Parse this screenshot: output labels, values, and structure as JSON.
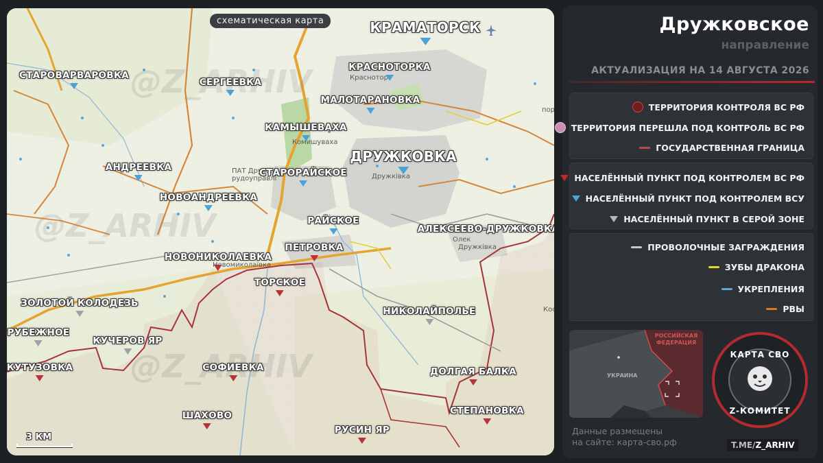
{
  "map": {
    "badge": "схематическая карта",
    "scale": "3 КМ",
    "watermark": "@Z_ARHIV",
    "under_labels": [
      "Краснотор",
      "Комишуваха",
      "ПАТ Дружків",
      "рудоуправлі",
      "Дружківка",
      "Олек",
      "Дружківка",
      "Новомиколаївка",
      "Кост",
      "пор"
    ],
    "towns": [
      {
        "name": "КРАМАТОРСК",
        "control": "ua",
        "size": "big"
      },
      {
        "name": "ДРУЖКОВКА",
        "control": "ua",
        "size": "big"
      },
      {
        "name": "СТАРОВАРВАРОВКА",
        "control": "ua"
      },
      {
        "name": "СЕРГЕЕВКА",
        "control": "ua"
      },
      {
        "name": "КРАСНОТОРКА",
        "control": "ua"
      },
      {
        "name": "МАЛОТАРАНОВКА",
        "control": "ua"
      },
      {
        "name": "КАМЫШЕВАХА",
        "control": "ua"
      },
      {
        "name": "АНДРЕЕВКА",
        "control": "ua"
      },
      {
        "name": "СТАРОРАЙСКОЕ",
        "control": "ua"
      },
      {
        "name": "НОВОАНДРЕЕВКА",
        "control": "ua"
      },
      {
        "name": "РАЙСКОЕ",
        "control": "ua"
      },
      {
        "name": "АЛЕКСЕЕВО-ДРУЖКОВКА",
        "control": "grey"
      },
      {
        "name": "ПЕТРОВКА",
        "control": "ru"
      },
      {
        "name": "НОВОНИКОЛАЕВКА",
        "control": "ru"
      },
      {
        "name": "ТОРСКОЕ",
        "control": "ru"
      },
      {
        "name": "ЗОЛОТОЙ КОЛОДЕЗЬ",
        "control": "grey"
      },
      {
        "name": "НИКОЛАЙПОЛЬЕ",
        "control": "grey"
      },
      {
        "name": "РУБЕЖНОЕ",
        "control": "grey"
      },
      {
        "name": "КУЧЕРОВ ЯР",
        "control": "grey"
      },
      {
        "name": "КУТУЗОВКА",
        "control": "ru"
      },
      {
        "name": "СОФИЕВКА",
        "control": "ru"
      },
      {
        "name": "ДОЛГАЯ БАЛКА",
        "control": "ru"
      },
      {
        "name": "СТЕПАНОВКА",
        "control": "ru"
      },
      {
        "name": "ШАХОВО",
        "control": "ru"
      },
      {
        "name": "РУСИН ЯР",
        "control": "ru"
      }
    ]
  },
  "panel": {
    "title": "Дружковское",
    "subtitle": "направление",
    "date": "АКТУАЛИЗАЦИЯ НА 14 АВГУСТА 2026",
    "legend1": [
      {
        "label": "ТЕРРИТОРИЯ КОНТРОЛЯ ВС РФ",
        "color": "#7a1f22"
      },
      {
        "label": "ТЕРРИТОРИЯ ПЕРЕШЛА ПОД КОНТРОЛЬ ВС РФ",
        "color": "#d9a3c4"
      },
      {
        "label": "ГОСУДАРСТВЕННАЯ ГРАНИЦА",
        "color": "#b94a4a"
      }
    ],
    "legend2": [
      {
        "label": "НАСЕЛЁННЫЙ ПУНКТ ПОД КОНТРОЛЕМ ВС РФ",
        "color": "#c0272d"
      },
      {
        "label": "НАСЕЛЁННЫЙ ПУНКТ ПОД КОНТРОЛЕМ ВСУ",
        "color": "#4aa3d8"
      },
      {
        "label": "НАСЕЛЁННЫЙ ПУНКТ В СЕРОЙ ЗОНЕ",
        "color": "#b5b8bb"
      }
    ],
    "legend3": [
      {
        "label": "ПРОВОЛОЧНЫЕ ЗАГРАЖДЕНИЯ",
        "color": "#c9c9c9"
      },
      {
        "label": "ЗУБЫ ДРАКОНА",
        "color": "#e8d52a"
      },
      {
        "label": "УКРЕПЛЕНИЯ",
        "color": "#58a9e0"
      },
      {
        "label": "РВЫ",
        "color": "#e07a1f"
      }
    ],
    "minimap": {
      "russia": "РОССИЙСКАЯ ФЕДЕРАЦИЯ",
      "ukraine": "УКРАИНА"
    },
    "logo": {
      "top": "КАРТА СВО",
      "bottom": "Z-КОМИТЕТ"
    },
    "site_line1": "Данные размещены",
    "site_line2": "на сайте: карта-сво.рф",
    "tme_prefix": "T.ME/",
    "tme_handle": "Z_ARHIV"
  }
}
